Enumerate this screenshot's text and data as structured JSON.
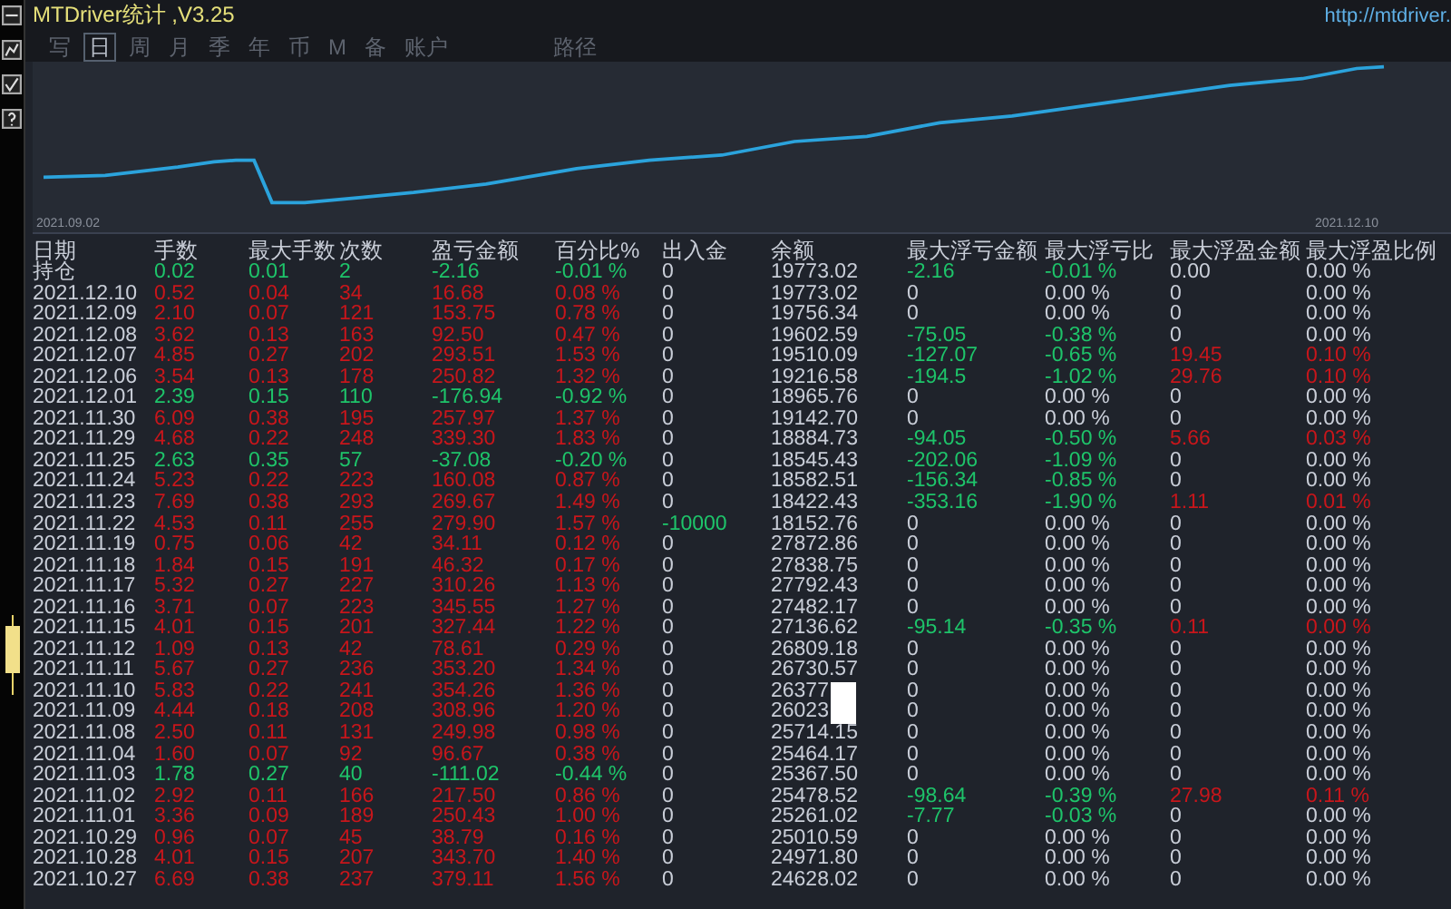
{
  "window": {
    "title": "MTDriver统计 ,V3.25",
    "url": "http://mtdriver."
  },
  "tabs": [
    {
      "label": "写",
      "selected": false
    },
    {
      "label": "日",
      "selected": true
    },
    {
      "label": "周",
      "selected": false
    },
    {
      "label": "月",
      "selected": false
    },
    {
      "label": "季",
      "selected": false
    },
    {
      "label": "年",
      "selected": false
    },
    {
      "label": "币",
      "selected": false
    },
    {
      "label": "M",
      "selected": false
    },
    {
      "label": "备",
      "selected": false
    },
    {
      "label": "账户",
      "selected": false
    },
    {
      "label": "路径",
      "selected": false
    }
  ],
  "balance_chart": {
    "start_label": "2021.09.02",
    "end_label": "2021.12.10"
  },
  "table": {
    "columns": [
      "日期",
      "手数",
      "最大手数",
      "次数",
      "盈亏金额",
      "百分比%",
      "出入金",
      "余额",
      "最大浮亏金额",
      "最大浮亏比",
      "最大浮盈金额",
      "最大浮盈比例"
    ],
    "rows": [
      {
        "cells": [
          "持仓",
          "0.02",
          "0.01",
          "2",
          "-2.16",
          "-0.01 %",
          "0",
          "19773.02",
          "-2.16",
          "-0.01 %",
          "0.00",
          "0.00 %"
        ],
        "loss_day": true,
        "flow_hit": false,
        "loss_hit": true,
        "gain_hit": false,
        "masked": false
      },
      {
        "cells": [
          "2021.12.10",
          "0.52",
          "0.04",
          "34",
          "16.68",
          "0.08 %",
          "0",
          "19773.02",
          "0",
          "0.00 %",
          "0",
          "0.00 %"
        ],
        "loss_day": false,
        "flow_hit": false,
        "loss_hit": false,
        "gain_hit": false,
        "masked": false
      },
      {
        "cells": [
          "2021.12.09",
          "2.10",
          "0.07",
          "121",
          "153.75",
          "0.78 %",
          "0",
          "19756.34",
          "0",
          "0.00 %",
          "0",
          "0.00 %"
        ],
        "loss_day": false,
        "flow_hit": false,
        "loss_hit": false,
        "gain_hit": false,
        "masked": false
      },
      {
        "cells": [
          "2021.12.08",
          "3.62",
          "0.13",
          "163",
          "92.50",
          "0.47 %",
          "0",
          "19602.59",
          "-75.05",
          "-0.38 %",
          "0",
          "0.00 %"
        ],
        "loss_day": false,
        "flow_hit": false,
        "loss_hit": true,
        "gain_hit": false,
        "masked": false
      },
      {
        "cells": [
          "2021.12.07",
          "4.85",
          "0.27",
          "202",
          "293.51",
          "1.53 %",
          "0",
          "19510.09",
          "-127.07",
          "-0.65 %",
          "19.45",
          "0.10 %"
        ],
        "loss_day": false,
        "flow_hit": false,
        "loss_hit": true,
        "gain_hit": true,
        "masked": false
      },
      {
        "cells": [
          "2021.12.06",
          "3.54",
          "0.13",
          "178",
          "250.82",
          "1.32 %",
          "0",
          "19216.58",
          "-194.5",
          "-1.02 %",
          "29.76",
          "0.10 %"
        ],
        "loss_day": false,
        "flow_hit": false,
        "loss_hit": true,
        "gain_hit": true,
        "masked": false
      },
      {
        "cells": [
          "2021.12.01",
          "2.39",
          "0.15",
          "110",
          "-176.94",
          "-0.92 %",
          "0",
          "18965.76",
          "0",
          "0.00 %",
          "0",
          "0.00 %"
        ],
        "loss_day": true,
        "flow_hit": false,
        "loss_hit": false,
        "gain_hit": false,
        "masked": false
      },
      {
        "cells": [
          "2021.11.30",
          "6.09",
          "0.38",
          "195",
          "257.97",
          "1.37 %",
          "0",
          "19142.70",
          "0",
          "0.00 %",
          "0",
          "0.00 %"
        ],
        "loss_day": false,
        "flow_hit": false,
        "loss_hit": false,
        "gain_hit": false,
        "masked": false
      },
      {
        "cells": [
          "2021.11.29",
          "4.68",
          "0.22",
          "248",
          "339.30",
          "1.83 %",
          "0",
          "18884.73",
          "-94.05",
          "-0.50 %",
          "5.66",
          "0.03 %"
        ],
        "loss_day": false,
        "flow_hit": false,
        "loss_hit": true,
        "gain_hit": true,
        "masked": false
      },
      {
        "cells": [
          "2021.11.25",
          "2.63",
          "0.35",
          "57",
          "-37.08",
          "-0.20 %",
          "0",
          "18545.43",
          "-202.06",
          "-1.09 %",
          "0",
          "0.00 %"
        ],
        "loss_day": true,
        "flow_hit": false,
        "loss_hit": true,
        "gain_hit": false,
        "masked": false
      },
      {
        "cells": [
          "2021.11.24",
          "5.23",
          "0.22",
          "223",
          "160.08",
          "0.87 %",
          "0",
          "18582.51",
          "-156.34",
          "-0.85 %",
          "0",
          "0.00 %"
        ],
        "loss_day": false,
        "flow_hit": false,
        "loss_hit": true,
        "gain_hit": false,
        "masked": false
      },
      {
        "cells": [
          "2021.11.23",
          "7.69",
          "0.38",
          "293",
          "269.67",
          "1.49 %",
          "0",
          "18422.43",
          "-353.16",
          "-1.90 %",
          "1.11",
          "0.01 %"
        ],
        "loss_day": false,
        "flow_hit": false,
        "loss_hit": true,
        "gain_hit": true,
        "masked": false
      },
      {
        "cells": [
          "2021.11.22",
          "4.53",
          "0.11",
          "255",
          "279.90",
          "1.57 %",
          "-10000",
          "18152.76",
          "0",
          "0.00 %",
          "0",
          "0.00 %"
        ],
        "loss_day": false,
        "flow_hit": true,
        "loss_hit": false,
        "gain_hit": false,
        "masked": false
      },
      {
        "cells": [
          "2021.11.19",
          "0.75",
          "0.06",
          "42",
          "34.11",
          "0.12 %",
          "0",
          "27872.86",
          "0",
          "0.00 %",
          "0",
          "0.00 %"
        ],
        "loss_day": false,
        "flow_hit": false,
        "loss_hit": false,
        "gain_hit": false,
        "masked": false
      },
      {
        "cells": [
          "2021.11.18",
          "1.84",
          "0.15",
          "191",
          "46.32",
          "0.17 %",
          "0",
          "27838.75",
          "0",
          "0.00 %",
          "0",
          "0.00 %"
        ],
        "loss_day": false,
        "flow_hit": false,
        "loss_hit": false,
        "gain_hit": false,
        "masked": false
      },
      {
        "cells": [
          "2021.11.17",
          "5.32",
          "0.27",
          "227",
          "310.26",
          "1.13 %",
          "0",
          "27792.43",
          "0",
          "0.00 %",
          "0",
          "0.00 %"
        ],
        "loss_day": false,
        "flow_hit": false,
        "loss_hit": false,
        "gain_hit": false,
        "masked": false
      },
      {
        "cells": [
          "2021.11.16",
          "3.71",
          "0.07",
          "223",
          "345.55",
          "1.27 %",
          "0",
          "27482.17",
          "0",
          "0.00 %",
          "0",
          "0.00 %"
        ],
        "loss_day": false,
        "flow_hit": false,
        "loss_hit": false,
        "gain_hit": false,
        "masked": false
      },
      {
        "cells": [
          "2021.11.15",
          "4.01",
          "0.15",
          "201",
          "327.44",
          "1.22 %",
          "0",
          "27136.62",
          "-95.14",
          "-0.35 %",
          "0.11",
          "0.00 %"
        ],
        "loss_day": false,
        "flow_hit": false,
        "loss_hit": true,
        "gain_hit": true,
        "masked": false
      },
      {
        "cells": [
          "2021.11.12",
          "1.09",
          "0.13",
          "42",
          "78.61",
          "0.29 %",
          "0",
          "26809.18",
          "0",
          "0.00 %",
          "0",
          "0.00 %"
        ],
        "loss_day": false,
        "flow_hit": false,
        "loss_hit": false,
        "gain_hit": false,
        "masked": false
      },
      {
        "cells": [
          "2021.11.11",
          "5.67",
          "0.27",
          "236",
          "353.20",
          "1.34 %",
          "0",
          "26730.57",
          "0",
          "0.00 %",
          "0",
          "0.00 %"
        ],
        "loss_day": false,
        "flow_hit": false,
        "loss_hit": false,
        "gain_hit": false,
        "masked": false
      },
      {
        "cells": [
          "2021.11.10",
          "5.83",
          "0.22",
          "241",
          "354.26",
          "1.36 %",
          "0",
          "26377",
          "0",
          "0.00 %",
          "0",
          "0.00 %"
        ],
        "loss_day": false,
        "flow_hit": false,
        "loss_hit": false,
        "gain_hit": false,
        "masked": true
      },
      {
        "cells": [
          "2021.11.09",
          "4.44",
          "0.18",
          "208",
          "308.96",
          "1.20 %",
          "0",
          "26023",
          "0",
          "0.00 %",
          "0",
          "0.00 %"
        ],
        "loss_day": false,
        "flow_hit": false,
        "loss_hit": false,
        "gain_hit": false,
        "masked": true
      },
      {
        "cells": [
          "2021.11.08",
          "2.50",
          "0.11",
          "131",
          "249.98",
          "0.98 %",
          "0",
          "25714.15",
          "0",
          "0.00 %",
          "0",
          "0.00 %"
        ],
        "loss_day": false,
        "flow_hit": false,
        "loss_hit": false,
        "gain_hit": false,
        "masked": false
      },
      {
        "cells": [
          "2021.11.04",
          "1.60",
          "0.07",
          "92",
          "96.67",
          "0.38 %",
          "0",
          "25464.17",
          "0",
          "0.00 %",
          "0",
          "0.00 %"
        ],
        "loss_day": false,
        "flow_hit": false,
        "loss_hit": false,
        "gain_hit": false,
        "masked": false
      },
      {
        "cells": [
          "2021.11.03",
          "1.78",
          "0.27",
          "40",
          "-111.02",
          "-0.44 %",
          "0",
          "25367.50",
          "0",
          "0.00 %",
          "0",
          "0.00 %"
        ],
        "loss_day": true,
        "flow_hit": false,
        "loss_hit": false,
        "gain_hit": false,
        "masked": false
      },
      {
        "cells": [
          "2021.11.02",
          "2.92",
          "0.11",
          "166",
          "217.50",
          "0.86 %",
          "0",
          "25478.52",
          "-98.64",
          "-0.39 %",
          "27.98",
          "0.11 %"
        ],
        "loss_day": false,
        "flow_hit": false,
        "loss_hit": true,
        "gain_hit": true,
        "masked": false
      },
      {
        "cells": [
          "2021.11.01",
          "3.36",
          "0.09",
          "189",
          "250.43",
          "1.00 %",
          "0",
          "25261.02",
          "-7.77",
          "-0.03 %",
          "0",
          "0.00 %"
        ],
        "loss_day": false,
        "flow_hit": false,
        "loss_hit": true,
        "gain_hit": false,
        "masked": false
      },
      {
        "cells": [
          "2021.10.29",
          "0.96",
          "0.07",
          "45",
          "38.79",
          "0.16 %",
          "0",
          "25010.59",
          "0",
          "0.00 %",
          "0",
          "0.00 %"
        ],
        "loss_day": false,
        "flow_hit": false,
        "loss_hit": false,
        "gain_hit": false,
        "masked": false
      },
      {
        "cells": [
          "2021.10.28",
          "4.01",
          "0.15",
          "207",
          "343.70",
          "1.40 %",
          "0",
          "24971.80",
          "0",
          "0.00 %",
          "0",
          "0.00 %"
        ],
        "loss_day": false,
        "flow_hit": false,
        "loss_hit": false,
        "gain_hit": false,
        "masked": false
      },
      {
        "cells": [
          "2021.10.27",
          "6.69",
          "0.38",
          "237",
          "379.11",
          "1.56 %",
          "0",
          "24628.02",
          "0",
          "0.00 %",
          "0",
          "0.00 %"
        ],
        "loss_day": false,
        "flow_hit": false,
        "loss_hit": false,
        "gain_hit": false,
        "masked": false
      }
    ]
  }
}
